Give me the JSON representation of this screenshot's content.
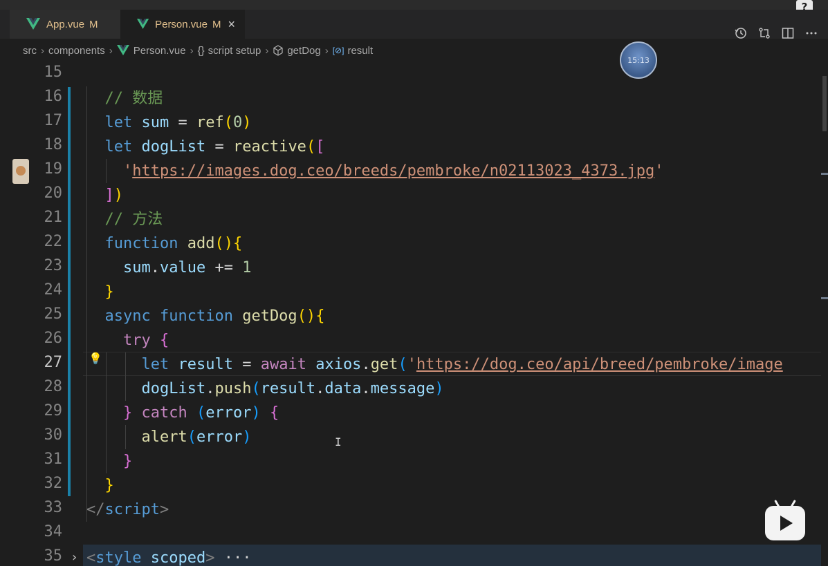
{
  "tabs": [
    {
      "name": "App.vue",
      "status": "M"
    },
    {
      "name": "Person.vue",
      "status": "M",
      "close": "×"
    }
  ],
  "breadcrumb": {
    "items": [
      "src",
      "components",
      "Person.vue",
      "script setup",
      "getDog",
      "result"
    ],
    "icons": [
      "",
      "",
      "vue-icon",
      "braces-icon",
      "cube-icon",
      "variable-icon"
    ],
    "braces_glyph": "{}",
    "variable_glyph": "[⊘]"
  },
  "clock": {
    "time": "15:13"
  },
  "help": {
    "label": "?"
  },
  "editor": {
    "current_line": 27,
    "line_numbers": [
      "15",
      "16",
      "17",
      "18",
      "19",
      "20",
      "21",
      "22",
      "23",
      "24",
      "25",
      "26",
      "27",
      "28",
      "29",
      "30",
      "31",
      "32",
      "33",
      "34",
      "35"
    ],
    "lines": [
      {
        "num": 15,
        "tokens": []
      },
      {
        "num": 16,
        "tokens": [
          [
            "c-comment",
            "  // 数据"
          ]
        ]
      },
      {
        "num": 17,
        "tokens": [
          [
            "c-plain",
            "  "
          ],
          [
            "c-kw",
            "let"
          ],
          [
            "c-plain",
            " "
          ],
          [
            "c-var",
            "sum"
          ],
          [
            "c-plain",
            " = "
          ],
          [
            "c-fn",
            "ref"
          ],
          [
            "c-b1",
            "("
          ],
          [
            "c-num",
            "0"
          ],
          [
            "c-b1",
            ")"
          ]
        ]
      },
      {
        "num": 18,
        "tokens": [
          [
            "c-plain",
            "  "
          ],
          [
            "c-kw",
            "let"
          ],
          [
            "c-plain",
            " "
          ],
          [
            "c-var",
            "dogList"
          ],
          [
            "c-plain",
            " = "
          ],
          [
            "c-fn",
            "reactive"
          ],
          [
            "c-b1",
            "("
          ],
          [
            "c-b2",
            "["
          ]
        ]
      },
      {
        "num": 19,
        "tokens": [
          [
            "c-plain",
            "    "
          ],
          [
            "c-str",
            "'"
          ],
          [
            "c-url",
            "https://images.dog.ceo/breeds/pembroke/n02113023_4373.jpg"
          ],
          [
            "c-str",
            "'"
          ]
        ]
      },
      {
        "num": 20,
        "tokens": [
          [
            "c-plain",
            "  "
          ],
          [
            "c-b2",
            "]"
          ],
          [
            "c-b1",
            ")"
          ]
        ]
      },
      {
        "num": 21,
        "tokens": [
          [
            "c-comment",
            "  // 方法"
          ]
        ]
      },
      {
        "num": 22,
        "tokens": [
          [
            "c-plain",
            "  "
          ],
          [
            "c-kw",
            "function"
          ],
          [
            "c-plain",
            " "
          ],
          [
            "c-fn",
            "add"
          ],
          [
            "c-b1",
            "()"
          ],
          [
            "c-b1",
            "{"
          ]
        ]
      },
      {
        "num": 23,
        "tokens": [
          [
            "c-plain",
            "    "
          ],
          [
            "c-var",
            "sum"
          ],
          [
            "c-plain",
            "."
          ],
          [
            "c-var",
            "value"
          ],
          [
            "c-plain",
            " += "
          ],
          [
            "c-num",
            "1"
          ]
        ]
      },
      {
        "num": 24,
        "tokens": [
          [
            "c-plain",
            "  "
          ],
          [
            "c-b1",
            "}"
          ]
        ]
      },
      {
        "num": 25,
        "tokens": [
          [
            "c-plain",
            "  "
          ],
          [
            "c-kw",
            "async"
          ],
          [
            "c-plain",
            " "
          ],
          [
            "c-kw",
            "function"
          ],
          [
            "c-plain",
            " "
          ],
          [
            "c-fn",
            "getDog"
          ],
          [
            "c-b1",
            "()"
          ],
          [
            "c-b1",
            "{"
          ]
        ]
      },
      {
        "num": 26,
        "tokens": [
          [
            "c-plain",
            "    "
          ],
          [
            "c-ctl",
            "try"
          ],
          [
            "c-plain",
            " "
          ],
          [
            "c-b2",
            "{"
          ]
        ]
      },
      {
        "num": 27,
        "tokens": [
          [
            "c-plain",
            "      "
          ],
          [
            "c-kw",
            "let"
          ],
          [
            "c-plain",
            " "
          ],
          [
            "c-var",
            "result"
          ],
          [
            "c-plain",
            " = "
          ],
          [
            "c-ctl",
            "await"
          ],
          [
            "c-plain",
            " "
          ],
          [
            "c-var",
            "axios"
          ],
          [
            "c-plain",
            "."
          ],
          [
            "c-fn",
            "get"
          ],
          [
            "c-b3",
            "("
          ],
          [
            "c-str",
            "'"
          ],
          [
            "c-url",
            "https://dog.ceo/api/breed/pembroke/image"
          ]
        ]
      },
      {
        "num": 28,
        "tokens": [
          [
            "c-plain",
            "      "
          ],
          [
            "c-var",
            "dogList"
          ],
          [
            "c-plain",
            "."
          ],
          [
            "c-fn",
            "push"
          ],
          [
            "c-b3",
            "("
          ],
          [
            "c-var",
            "result"
          ],
          [
            "c-plain",
            "."
          ],
          [
            "c-var",
            "data"
          ],
          [
            "c-plain",
            "."
          ],
          [
            "c-var",
            "message"
          ],
          [
            "c-b3",
            ")"
          ]
        ]
      },
      {
        "num": 29,
        "tokens": [
          [
            "c-plain",
            "    "
          ],
          [
            "c-b2",
            "}"
          ],
          [
            "c-plain",
            " "
          ],
          [
            "c-ctl",
            "catch"
          ],
          [
            "c-plain",
            " "
          ],
          [
            "c-b3",
            "("
          ],
          [
            "c-var",
            "error"
          ],
          [
            "c-b3",
            ")"
          ],
          [
            "c-plain",
            " "
          ],
          [
            "c-b2",
            "{"
          ]
        ]
      },
      {
        "num": 30,
        "tokens": [
          [
            "c-plain",
            "      "
          ],
          [
            "c-fn",
            "alert"
          ],
          [
            "c-b3",
            "("
          ],
          [
            "c-var",
            "error"
          ],
          [
            "c-b3",
            ")"
          ]
        ]
      },
      {
        "num": 31,
        "tokens": [
          [
            "c-plain",
            "    "
          ],
          [
            "c-b2",
            "}"
          ]
        ]
      },
      {
        "num": 32,
        "tokens": [
          [
            "c-plain",
            "  "
          ],
          [
            "c-b1",
            "}"
          ]
        ]
      },
      {
        "num": 33,
        "tokens": [
          [
            "c-tag",
            "</"
          ],
          [
            "c-tagname",
            "script"
          ],
          [
            "c-tag",
            ">"
          ]
        ]
      },
      {
        "num": 34,
        "tokens": []
      },
      {
        "num": 35,
        "tokens": [
          [
            "c-tag",
            "<"
          ],
          [
            "c-tagname",
            "style"
          ],
          [
            "c-plain",
            " "
          ],
          [
            "c-attr",
            "scoped"
          ],
          [
            "c-tag",
            ">"
          ],
          [
            "c-plain",
            " ···"
          ]
        ]
      }
    ]
  },
  "colors": {
    "background": "#1e1e1e",
    "tabbar": "#252526",
    "modified": "#e2c08d",
    "vue_green": "#41b883",
    "gutter_modified": "#1b81a8"
  }
}
